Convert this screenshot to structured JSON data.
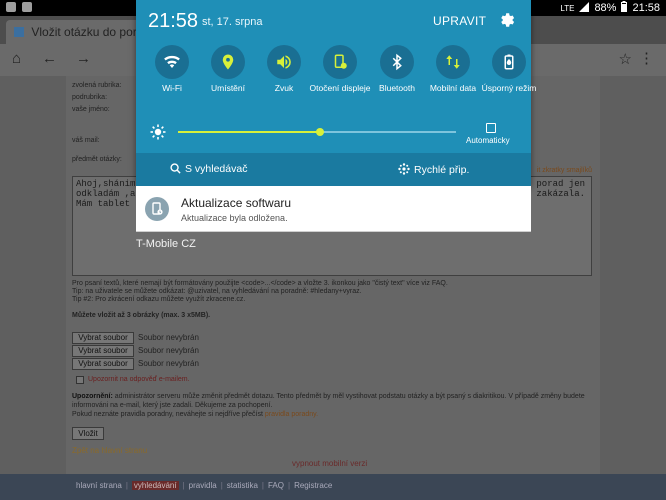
{
  "status_bar": {
    "signal": "LTE",
    "battery": "88%",
    "time": "21:58"
  },
  "browser": {
    "tab_title": "Vložit otázku do poradn",
    "nav": {
      "home": "⌂",
      "back": "←",
      "forward": "→",
      "reload": "↻"
    },
    "star": "☆",
    "menu": "⋮"
  },
  "page": {
    "form_labels": [
      "zvolená rubrika:",
      "podrubrika:",
      "vaše jméno:",
      "váš mail:",
      "předmět otázky:"
    ],
    "title_warning_link": "it zkratky smajlíků",
    "textarea_lines": [
      "Ahoj,shánim",
      "odkladám ,al",
      "Mám tablet g"
    ],
    "textarea_right_lines": [
      "porad jen",
      "zakázala."
    ],
    "help_lines": [
      "Pro psaní textů, které nemají být formátovány použijte <code>...</code> a vložte 3. ikonkou jako \"čistý text\" více viz FAQ.",
      "Tip: na uživatele se můžete odkázat: @uzivatel, na vyhledávání na poradně: #hledany+vyraz.",
      "Tip #2: Pro zkrácení odkazu můžete využít zkracene.cz."
    ],
    "upload_title": "Můžete vložit až 3 obrázky (max. 3 x5MB).",
    "file_button": "Vybrat soubor",
    "file_none": "Soubor nevybrán",
    "notify_label": "Upozornit na odpověď e-mailem.",
    "notice_title": "Upozornění:",
    "notice_text": "administrátor serveru může změnit předmět dotazu. Tento předmět by měl vystihovat podstatu otázky a být psaný s diakritikou. V případě změny budete informováni na e-mail, který jste zadali. Děkujeme za pochopení.",
    "notice_rules": "Pokud neznáte pravidla poradny, neváhejte si nejdříve přečíst",
    "notice_rules_link": "pravidla poradny.",
    "submit": "Vložit",
    "back_link": "Zpět na hlavní stranu",
    "mobile_off": "vypnout mobilní verzi",
    "footer_nav": [
      "hlavní strana",
      "vyhledávání",
      "pravidla",
      "statistika",
      "FAQ",
      "Registrace"
    ],
    "footer_active": 1
  },
  "shade": {
    "clock": "21:58",
    "date": "st, 17. srpna",
    "edit_label": "UPRAVIT",
    "quick_settings": [
      {
        "id": "wifi",
        "label": "Wi-Fi",
        "icon": "wifi-icon"
      },
      {
        "id": "location",
        "label": "Umístění",
        "icon": "location-icon"
      },
      {
        "id": "sound",
        "label": "Zvuk",
        "icon": "volume-icon"
      },
      {
        "id": "rotate",
        "label": "Otočení displeje",
        "icon": "rotate-icon"
      },
      {
        "id": "bluetooth",
        "label": "Bluetooth",
        "icon": "bluetooth-icon"
      },
      {
        "id": "data",
        "label": "Mobilní data",
        "icon": "mobile-data-icon"
      },
      {
        "id": "saver",
        "label": "Úsporný režim",
        "icon": "battery-saver-icon"
      }
    ],
    "brightness": 0.51,
    "auto_label": "Automaticky",
    "s_finder": "S vyhledávač",
    "quick_connect": "Rychlé přip.",
    "accent": "#d7f03a",
    "shade_color": "#1f8fb7"
  },
  "notification": {
    "title": "Aktualizace softwaru",
    "body": "Aktualizace byla odložena."
  },
  "carrier": "T-Mobile CZ"
}
